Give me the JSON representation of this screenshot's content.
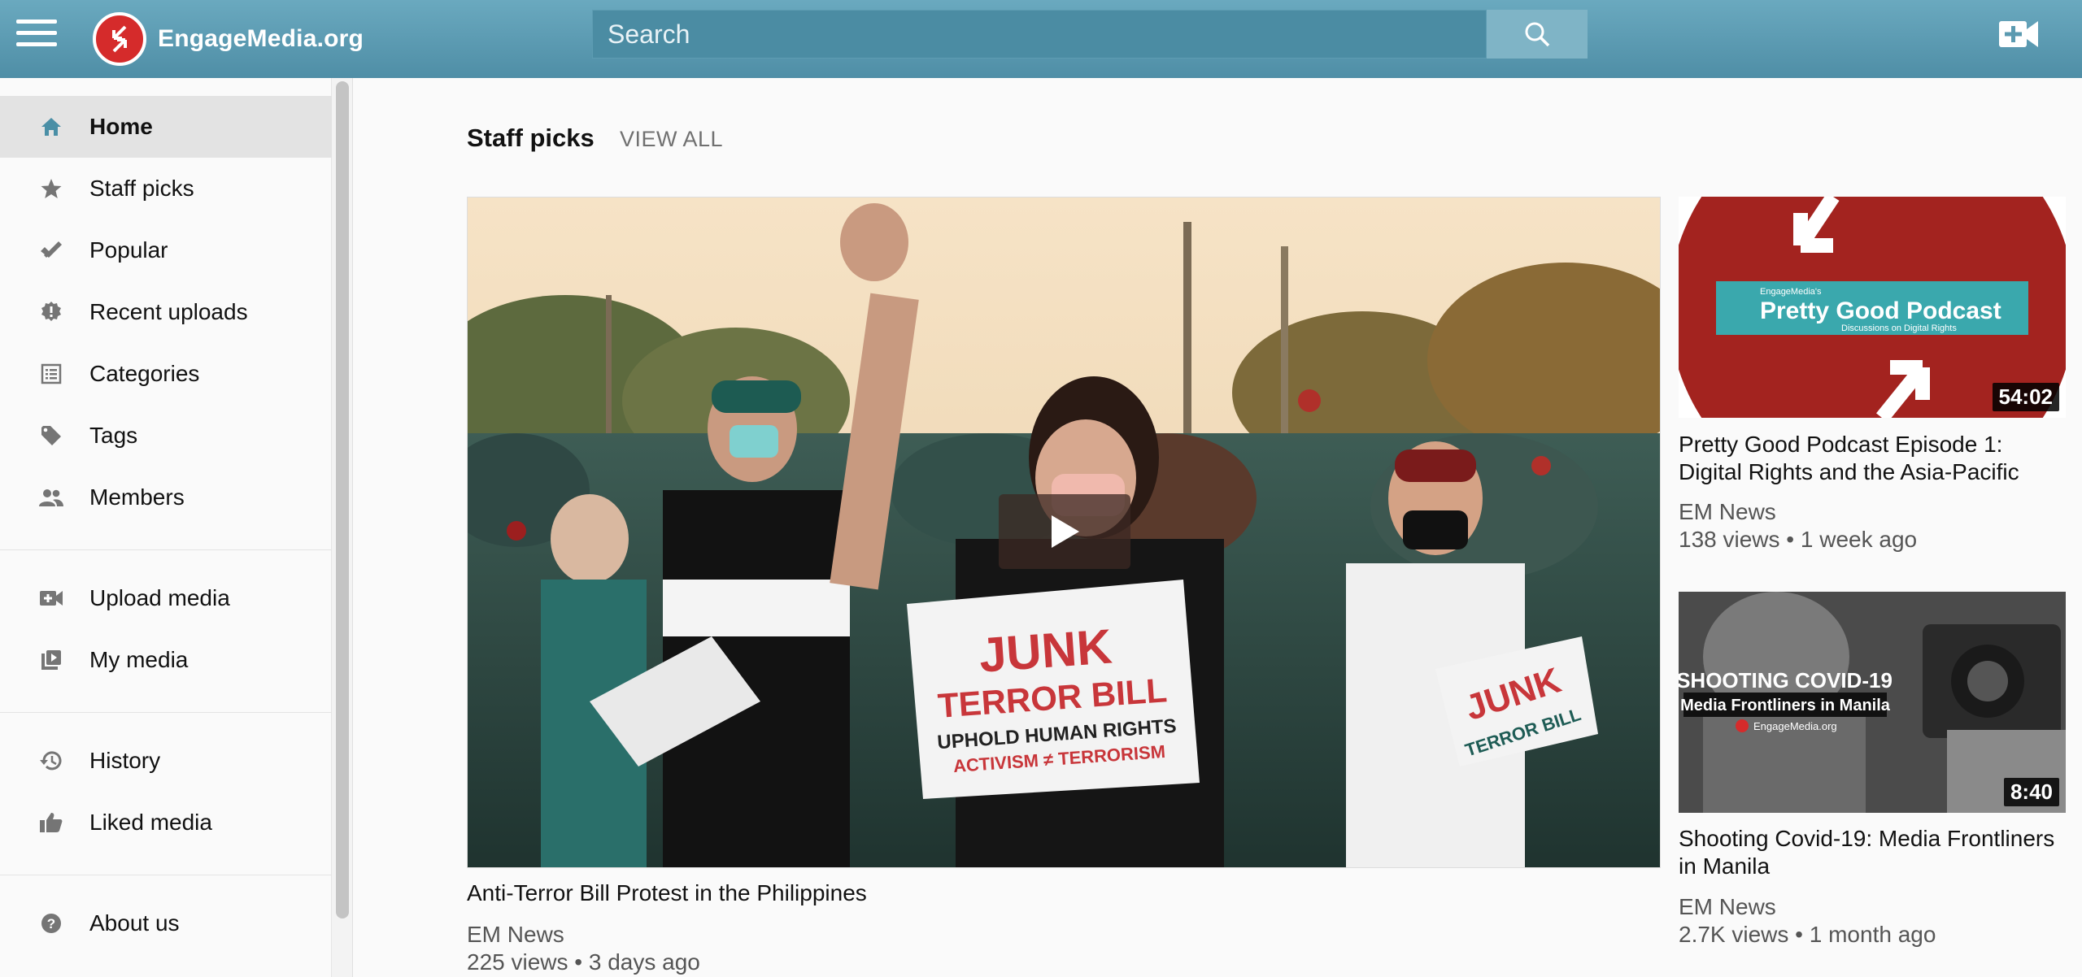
{
  "header": {
    "site_name": "EngageMedia.org",
    "search_placeholder": "Search"
  },
  "sidebar": {
    "items": [
      {
        "label": "Home",
        "icon": "home-icon",
        "active": true
      },
      {
        "label": "Staff picks",
        "icon": "star-icon"
      },
      {
        "label": "Popular",
        "icon": "checkmark-icon"
      },
      {
        "label": "Recent uploads",
        "icon": "new-badge-icon"
      },
      {
        "label": "Categories",
        "icon": "list-icon"
      },
      {
        "label": "Tags",
        "icon": "tag-icon"
      },
      {
        "label": "Members",
        "icon": "people-icon"
      },
      {
        "label": "Upload media",
        "icon": "video-add-icon"
      },
      {
        "label": "My media",
        "icon": "video-library-icon"
      },
      {
        "label": "History",
        "icon": "history-icon"
      },
      {
        "label": "Liked media",
        "icon": "thumbs-up-icon"
      },
      {
        "label": "About us",
        "icon": "help-icon"
      }
    ]
  },
  "main": {
    "section_title": "Staff picks",
    "view_all": "VIEW ALL",
    "featured": {
      "title": "Anti-Terror Bill Protest in the Philippines",
      "author": "EM News",
      "meta": "225 views • 3 days ago",
      "sign_line1": "JUNK",
      "sign_line2": "TERROR BILL",
      "sign_line3": "UPHOLD HUMAN RIGHTS",
      "sign_line4": "ACTIVISM ≠ TERRORISM",
      "sign2_line1": "JUNK",
      "sign2_line2": "TERROR BILL"
    },
    "videos": [
      {
        "title": "Pretty Good Podcast Episode 1: Digital Rights and the Asia-Pacific",
        "author": "EM News",
        "meta": "138 views • 1 week ago",
        "duration": "54:02",
        "thumb_small": "EngageMedia's",
        "thumb_big": "Pretty Good Podcast",
        "thumb_sub": "Discussions on Digital Rights"
      },
      {
        "title": "Shooting Covid-19: Media Frontliners in Manila",
        "author": "EM News",
        "meta": "2.7K views • 1 month ago",
        "duration": "8:40",
        "thumb_line1": "SHOOTING COVID-19",
        "thumb_line2": "Media Frontliners in Manila",
        "thumb_brand": "EngageMedia.org"
      }
    ]
  }
}
